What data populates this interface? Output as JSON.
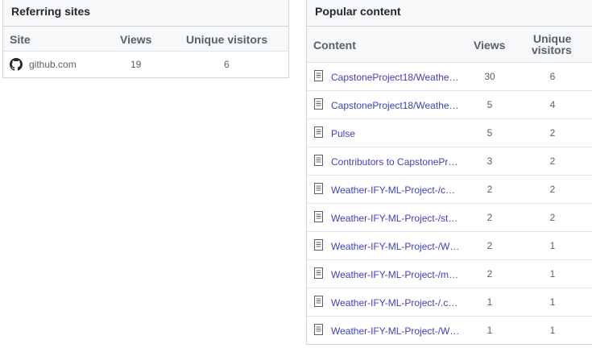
{
  "referring_sites": {
    "title": "Referring sites",
    "columns": {
      "site": "Site",
      "views": "Views",
      "unique": "Unique visitors"
    },
    "rows": [
      {
        "site": "github.com",
        "icon": "github-icon",
        "views": "19",
        "unique": "6"
      }
    ]
  },
  "popular_content": {
    "title": "Popular content",
    "columns": {
      "content": "Content",
      "views": "Views",
      "unique_line1": "Unique",
      "unique_line2": "visitors"
    },
    "rows": [
      {
        "title": "CapstoneProject18/Weathe…",
        "views": "30",
        "unique": "6"
      },
      {
        "title": "CapstoneProject18/Weathe…",
        "views": "5",
        "unique": "4"
      },
      {
        "title": "Pulse",
        "views": "5",
        "unique": "2"
      },
      {
        "title": "Contributors to CapstonePr…",
        "views": "3",
        "unique": "2"
      },
      {
        "title": "Weather-IFY-ML-Project-/co…",
        "views": "2",
        "unique": "2"
      },
      {
        "title": "Weather-IFY-ML-Project-/st…",
        "views": "2",
        "unique": "2"
      },
      {
        "title": "Weather-IFY-ML-Project-/W…",
        "views": "2",
        "unique": "1"
      },
      {
        "title": "Weather-IFY-ML-Project-/m…",
        "views": "2",
        "unique": "1"
      },
      {
        "title": "Weather-IFY-ML-Project-/.c…",
        "views": "1",
        "unique": "1"
      },
      {
        "title": "Weather-IFY-ML-Project-/W…",
        "views": "1",
        "unique": "1"
      }
    ]
  },
  "colors": {
    "link": "#4040c0",
    "header_bg": "#f6f8fa",
    "border": "#d1d5da"
  }
}
